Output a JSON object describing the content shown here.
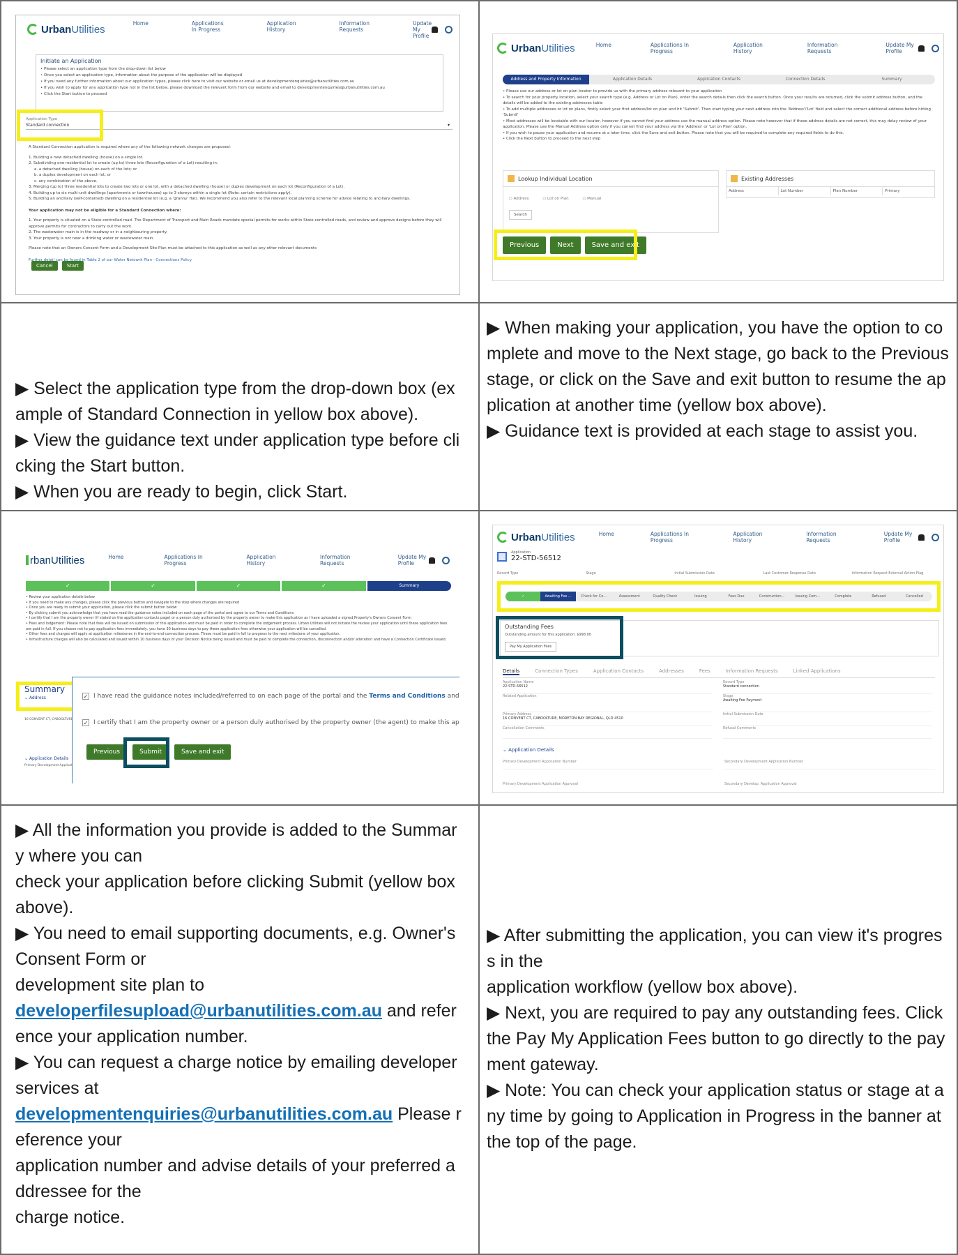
{
  "nav": {
    "logo_strong": "Urban",
    "logo_light": "Utilities",
    "logo_partial": "rbanUtilities",
    "items": [
      "Home",
      "Applications In Progress",
      "Application History",
      "Information Requests",
      "Update My Profile"
    ]
  },
  "shot1": {
    "title": "Initiate an Application",
    "bullets": [
      "Please select an application type from the drop-down list below",
      "Once you select an application type, information about the purpose of the application will be displayed",
      "If you need any further information about our application types, please click here to visit our website or email us at developmentenquiries@urbanutilities.com.au",
      "If you wish to apply for any application type not in the list below, please download the relevant form from our website and email to developmentenquiries@urbanutilities.com.au",
      "Click the Start button to proceed"
    ],
    "type_label": "Application Type",
    "type_value": "Standard connection",
    "intro": "A Standard Connection application is required where any of the following network changes are proposed:",
    "list": [
      "1. Building a new detached dwelling (house) on a single lot.",
      "2. Subdividing one residential lot to create (up to) three lots (Reconfiguration of a Lot) resulting in:",
      "   a. a detached dwelling (house) on each of the lots; or",
      "   b. a duplex development on each lot; or",
      "   c. any combination of the above.",
      "3. Merging (up to) three residential lots to create two lots or one lot, with a detached dwelling (house) or duplex development on each lot (Reconfiguration of a Lot).",
      "4. Building up to six multi-unit dwellings (apartments or townhouses) up to 3 storeys within a single lot (Note: certain restrictions apply).",
      "5. Building an ancillary (self-contained) dwelling on a residential lot (e.g. a 'granny' flat). We recommend you also refer to the relevant local planning scheme for advice relating to ancillary dwellings."
    ],
    "not_eligible": "Your application may not be eligible for a Standard Connection where:",
    "list2": [
      "1. Your property is situated on a State-controlled road. The Department of Transport and Main Roads mandate special permits for works within State-controlled roads, and review and approve designs before they will approve permits for contractors to carry out the work.",
      "2. The wastewater main is in the roadway or in a neighbouring property.",
      "3. Your property is not near a drinking water or wastewater main."
    ],
    "note": "Please note that an Owners Consent Form and a Development Site Plan must be attached to this application as well as any other relevant documents",
    "further": "Further detail can be found in Table 2 of our Water Netowrk Plan - Connections Policy",
    "cancel": "Cancel",
    "start": "Start"
  },
  "shot2": {
    "steps": [
      "Address and Property Information",
      "Application Details",
      "Application Contacts",
      "Connection Details",
      "Summary"
    ],
    "bullets": [
      "Please use our address or lot on plan locator to provide us with the primary address relevant to your application",
      "To search for your property location, select your search type (e.g. Address or Lot on Plan), enter the search details then click the search button. Once your results are returned, click the submit address button, and the details will be added to the existing addresses table",
      "To add multiple addresses or lot on plans, firstly select your first address/lot on plan and hit 'Submit'. Then start typing your next address into the 'Address'/'Lot' field and select the correct additional address before hitting 'Submit'",
      "Most addresses will be locatable with our locator, however if you cannot find your address use the manual address option. Please note however that if these address details are not correct, this may delay review of your application. Please use the Manual Address option only if you cannot find your address via the 'Address' or 'Lot on Plan' option.",
      "If you wish to pause your application and resume at a later time, click the Save and exit button. Please note that you will be required to complete any required fields to do this.",
      "Click the Next button to proceed to the next step"
    ],
    "lookup": "Lookup Individual Location",
    "existing": "Existing Addresses",
    "radios": [
      "Address",
      "Lot on Plan",
      "Manual"
    ],
    "search": "Search",
    "cols": [
      "Address",
      "Lot Number",
      "Plan Number",
      "Primary"
    ],
    "prev": "Previous",
    "next": "Next",
    "save": "Save and exit"
  },
  "shot3": {
    "summary_step": "Summary",
    "bullets": [
      "Review your application details below",
      "If you need to make any changes, please click the previous button and navigate to the step where changes are required",
      "Once you are ready to submit your application, please click the submit button below",
      "By clicking submit you acknowledge that you have read the guidance notes included on each page of the portal and agree to our Terms and Conditions",
      "I certify that I am the property owner (if stated on the application contacts page) or a person duly authorised by the property owner to make this application as I have uploaded a signed Property's Owners Consent Form",
      "Fees and lodgement: Please note that fees will be issued on submission of this application and must be paid in order to complete the lodgement process. Urban Utilities will not initiate the review your application until these application fees are paid in full. If you choose not to pay application fees immediately, you have 30 business days to pay these application fees otherwise your application will be cancelled.",
      "Other fees and charges will apply at application milestones in the end-to-end connection process. These must be paid in full to progress to the next milestone of your application.",
      "Infrastructure charges will also be calculated and issued within 10 business days of your Decision Notice being issued and must be paid to complete the connection, disconnection and/or alteration and have a Connection Certificate issued."
    ],
    "summary": "Summary",
    "address": "Address",
    "address_label": "Address",
    "address_value": "16 CONVENT CT, CABOOLTURE",
    "app_details": "Application Details",
    "primary_dev": "Primary Development Application",
    "check1": "I have read the guidance notes included/referred to on each page of the portal and the",
    "terms": "Terms and Conditions",
    "check1_tail": "and agree to thos",
    "check2": "I certify that I am the property owner or a person duly authorised by the property owner (the agent) to make this application as",
    "prev": "Previous",
    "submit": "Submit",
    "save": "Save and exit"
  },
  "shot4": {
    "app_label": "Application",
    "app_number": "22-STD-56512",
    "meta": [
      "Record Type",
      "Stage",
      "Initial Submission Date",
      "Last Customer Response Date",
      "Information Request External Action Flag"
    ],
    "workflow": [
      "Awaiting Fee ...",
      "Check for Co...",
      "Assessment",
      "Quality Check",
      "Issuing",
      "Fees Due",
      "Construction...",
      "Issuing Com...",
      "Complete",
      "Refused",
      "Cancelled"
    ],
    "fees_title": "Outstanding Fees",
    "fees_text": "Outstanding amount for this application: $998.00",
    "pay": "Pay My Application Fees",
    "tabs": [
      "Details",
      "Connection Types",
      "Application Contacts",
      "Addresses",
      "Fees",
      "Information Requests",
      "Linked Applications"
    ],
    "fields_left": [
      {
        "label": "Application Name",
        "value": "22-STD-56512"
      },
      {
        "label": "Related Application",
        "value": ""
      },
      {
        "label": "Primary Address",
        "value": "16 CONVENT CT, CABOOLTURE, MORETON BAY REGIONAL, QLD 4510"
      },
      {
        "label": "Cancellation Comments",
        "value": ""
      }
    ],
    "fields_right": [
      {
        "label": "Record Type",
        "value": "Standard connection"
      },
      {
        "label": "Stage",
        "value": "Awaiting Fee Payment"
      },
      {
        "label": "Initial Submission Date",
        "value": ""
      },
      {
        "label": "Refusal Comments",
        "value": ""
      }
    ],
    "app_details": "Application Details",
    "bottom_fields": [
      "Primary Development Application Number",
      "Secondary Development Application Number",
      "Primary Development Application Approval",
      "Secondary Develop. Application Approval"
    ]
  },
  "text1": {
    "p1": "▶ Select the application type from the drop-down box (example of Standard Connection in yellow box above).",
    "p2": "▶  View the guidance text under application type before clicking the Start button.",
    "p3": "▶ When you are ready to begin, click Start."
  },
  "text2": {
    "p1": "▶ When making your application, you have the option to complete and move to the Next stage, go back to the Previous stage, or click on the Save and exit button to resume the application at another time (yellow box above).",
    "p2": "▶ Guidance text is provided at each stage to assist you."
  },
  "text3": {
    "p1a": "▶ All the information you provide is added to the Summary where you can",
    "p1b": "check your application before clicking Submit (yellow box above).",
    "p2a": "▶ You need to email supporting documents, e.g. Owner's Consent Form or",
    "p2b": "development site plan to",
    "email1": "developerfilesupload@urbanutilities.com.au",
    "p2c": " and reference your application number.",
    "p3a": "▶ You can request a charge notice by emailing developer services at",
    "email2": "developmentenquiries@urbanutilities.com.au",
    "p3b": " Please reference your",
    "p3c": "application number and advise details of your preferred addressee for the",
    "p3d": "charge notice."
  },
  "text4": {
    "p1a": "▶ After submitting the application, you can view it's progress in the",
    "p1b": "application workflow (yellow box above).",
    "p2": "▶ Next, you are required to pay any outstanding fees. Click the Pay My Application Fees button to go directly to the payment gateway.",
    "p3": "▶ Note: You can check your application status or stage at any time by going to Application in Progress in the banner at the top of the page."
  },
  "colors": {
    "yellow": "#f6ee1a",
    "teal": "#0b4e5f",
    "green": "#3f7a2a",
    "navy": "#1e3f8a",
    "wfgreen": "#5cc15a"
  }
}
